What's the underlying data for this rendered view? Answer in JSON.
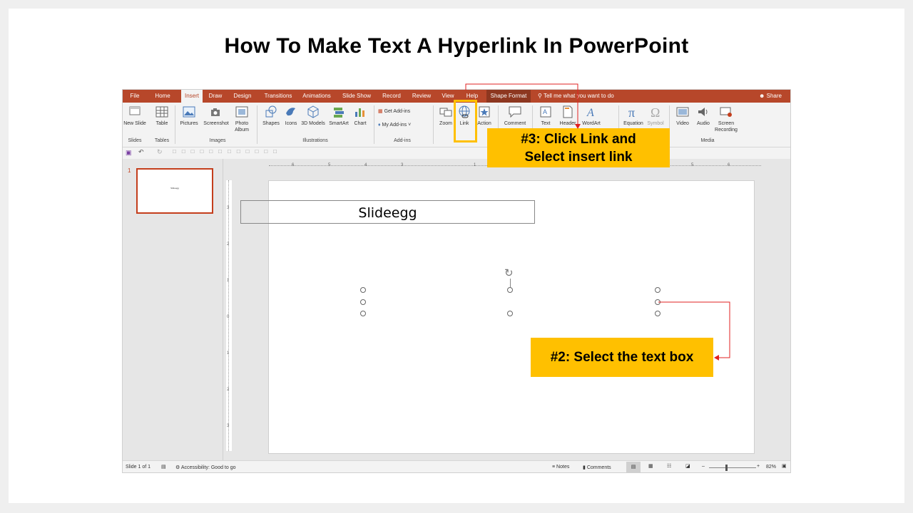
{
  "page_title": "How To Make Text A Hyperlink In PowerPoint",
  "tabs": [
    "File",
    "Home",
    "Insert",
    "Draw",
    "Design",
    "Transitions",
    "Animations",
    "Slide Show",
    "Record",
    "Review",
    "View",
    "Help",
    "Shape Format"
  ],
  "active_tab": "Insert",
  "tell_me": "Tell me what you want to do",
  "share": "Share",
  "ribbon": {
    "new_slide": "New Slide",
    "table": "Table",
    "pictures": "Pictures",
    "screenshot": "Screenshot",
    "photo_album": "Photo Album",
    "shapes": "Shapes",
    "icons": "Icons",
    "models_3d": "3D Models",
    "smartart": "SmartArt",
    "chart": "Chart",
    "get_addins": "Get Add-ins",
    "my_addins": "My Add-ins",
    "zoom": "Zoom",
    "link": "Link",
    "action": "Action",
    "comment": "Comment",
    "text": "Text",
    "header": "Header",
    "wordart": "WordArt",
    "equation": "Equation",
    "symbol": "Symbol",
    "video": "Video",
    "audio": "Audio",
    "screen_recording": "Screen Recording"
  },
  "groups": {
    "slides": "Slides",
    "tables": "Tables",
    "images": "Images",
    "illustrations": "Illustrations",
    "addins": "Add-ins",
    "media": "Media"
  },
  "thumbnail": {
    "number": "1",
    "text": "Slideegg"
  },
  "ruler_h": [
    "6",
    "5",
    "4",
    "3",
    "1",
    "5",
    "6"
  ],
  "ruler_v": [
    "3",
    "2",
    "1",
    "0",
    "1",
    "2",
    "3"
  ],
  "textbox_text": "Slideegg",
  "callout_3": {
    "line1": "#3: Click Link and",
    "line2": "Select insert link"
  },
  "callout_2": "#2: Select the text box",
  "status": {
    "slide_info": "Slide 1 of 1",
    "accessibility": "Accessibility: Good to go",
    "notes": "Notes",
    "comments": "Comments",
    "zoom": "82%"
  },
  "colors": {
    "accent": "#b7472a",
    "callout": "#ffc000",
    "arrow": "#e02020"
  }
}
